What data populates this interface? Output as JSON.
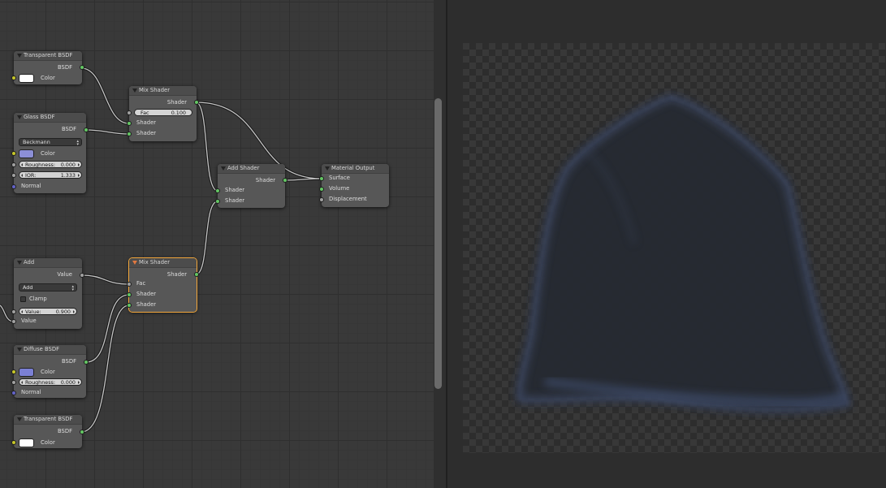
{
  "nodes": {
    "transparent_bsdf_1": {
      "title": "Transparent BSDF",
      "output": "BSDF",
      "input": "Color",
      "swatch": "#ffffff"
    },
    "glass_bsdf": {
      "title": "Glass BSDF",
      "output": "BSDF",
      "distribution": "Beckmann",
      "color_label": "Color",
      "swatch": "#8c8fd6",
      "roughness_label": "Roughness:",
      "roughness_value": "0.000",
      "ior_label": "IOR:",
      "ior_value": "1.333",
      "normal_label": "Normal"
    },
    "mix_shader_1": {
      "title": "Mix Shader",
      "output": "Shader",
      "fac_label": "Fac",
      "fac_value": "0.100",
      "in1": "Shader",
      "in2": "Shader"
    },
    "add_shader": {
      "title": "Add Shader",
      "output": "Shader",
      "in1": "Shader",
      "in2": "Shader"
    },
    "material_output": {
      "title": "Material Output",
      "surface": "Surface",
      "volume": "Volume",
      "displacement": "Displacement"
    },
    "add_math": {
      "title": "Add",
      "output": "Value",
      "operation": "Add",
      "clamp_label": "Clamp",
      "value_label": "Value:",
      "value": "0.900",
      "input": "Value"
    },
    "mix_shader_2": {
      "title": "Mix Shader",
      "output": "Shader",
      "fac_label": "Fac",
      "in1": "Shader",
      "in2": "Shader"
    },
    "diffuse_bsdf": {
      "title": "Diffuse BSDF",
      "output": "BSDF",
      "color_label": "Color",
      "swatch": "#7b80d4",
      "roughness_label": "Roughness:",
      "roughness_value": "0.000",
      "normal_label": "Normal"
    },
    "transparent_bsdf_2": {
      "title": "Transparent BSDF",
      "output": "BSDF",
      "input": "Color",
      "swatch": "#ffffff"
    }
  },
  "colors": {
    "socket_shader": "#63c763",
    "socket_color": "#c7c729",
    "socket_value": "#a1a1a1",
    "socket_vector": "#6363c7",
    "active_node_outline": "#f3a73b"
  }
}
